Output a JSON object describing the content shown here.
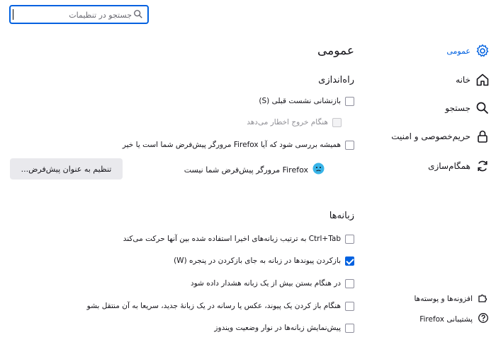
{
  "search": {
    "placeholder": "جستجو در تنظیمات",
    "value": ""
  },
  "sidebar": {
    "items": [
      {
        "label": "عمومی",
        "icon": "gear-icon",
        "active": true
      },
      {
        "label": "خانه",
        "icon": "home-icon",
        "active": false
      },
      {
        "label": "جستجو",
        "icon": "search-icon",
        "active": false
      },
      {
        "label": "حریم‌خصوصی و امنیت",
        "icon": "lock-icon",
        "active": false
      },
      {
        "label": "همگام‌سازی",
        "icon": "sync-icon",
        "active": false
      }
    ],
    "footer": [
      {
        "label": "افزونه‌ها و پوسته‌ها",
        "icon": "puzzle-icon"
      },
      {
        "label": "پشتیبانی Firefox",
        "icon": "help-icon"
      }
    ]
  },
  "main": {
    "title": "عمومی",
    "startup": {
      "heading": "راه‌اندازی",
      "restore_session": {
        "label": "بازنشانی نشست قبلی (S)",
        "checked": false
      },
      "warn_on_quit": {
        "label": "هنگام خروج اخطار می‌دهد",
        "checked": false,
        "disabled": true
      },
      "check_default": {
        "label": "همیشه بررسی شود که آیا Firefox مرورگر پیش‌فرض شما است یا خیر",
        "checked": false
      },
      "default_status": "Firefox مرورگر پیش‌فرض شما نیست",
      "make_default_button": "تنظیم به عنوان پیش‌فرض..."
    },
    "tabs": {
      "heading": "زبانه‌ها",
      "options": [
        {
          "label": "Ctrl+Tab به ترتیب زبانه‌های اخیرا استفاده شده بین آنها حرکت می‌کند",
          "checked": false
        },
        {
          "label": "بازکردن پیوندها در زبانه به جای بازکردن در پنجره (W)",
          "checked": true
        },
        {
          "label": "در هنگام بستن بیش از یک زبانه هشدار داده شود",
          "checked": false
        },
        {
          "label": "هنگام باز کردن یک پیوند، عکس یا رسانه در یک زبانهٔ جدید، سریعا به آن منتقل بشو",
          "checked": false
        },
        {
          "label": "پیش‌نمایش زبانه‌ها در نوار وضعیت ویندوز",
          "checked": false
        }
      ]
    }
  },
  "colors": {
    "accent": "#0061e0",
    "text": "#15141a",
    "button_bg": "#e9e9ed"
  }
}
